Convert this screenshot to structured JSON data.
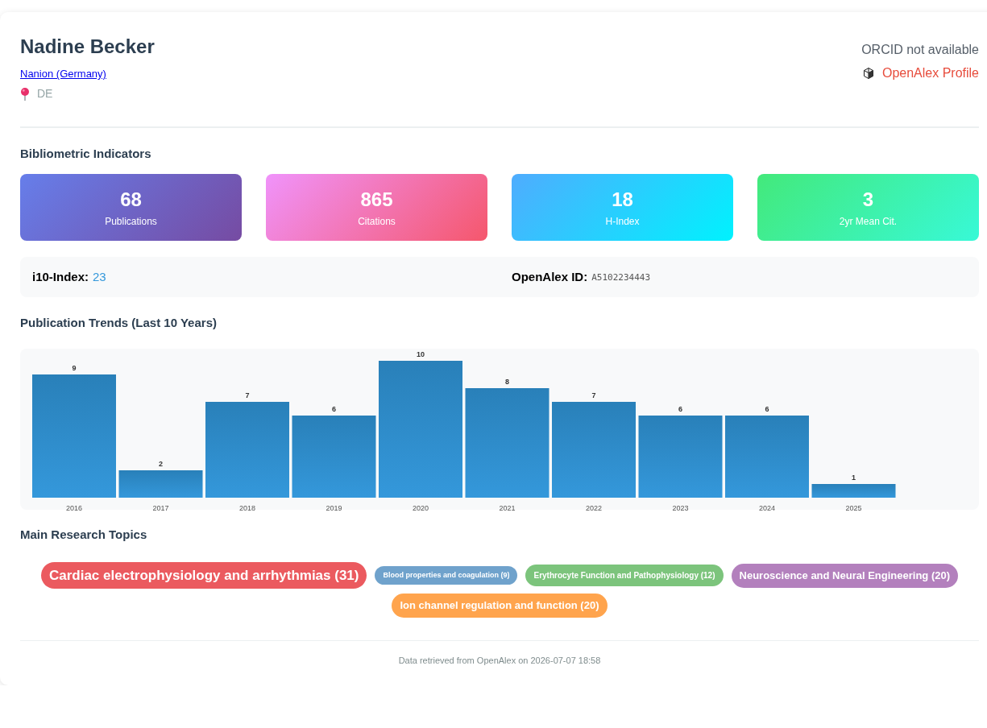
{
  "profile": {
    "name": "Nadine Becker",
    "affiliation": "Nanion (Germany)",
    "country": "DE",
    "orcid": "ORCID not available",
    "openalex_link": "OpenAlex Profile"
  },
  "bibliometric_indicators": {
    "title": "Bibliometric Indicators",
    "stats": [
      {
        "value": "68",
        "label": "Publications",
        "kind": "violet"
      },
      {
        "value": "865",
        "label": "Citations",
        "kind": "rose"
      },
      {
        "value": "18",
        "label": "H-Index",
        "kind": "azure"
      },
      {
        "value": "3",
        "label": "2yr Mean Cit.",
        "kind": "mint"
      }
    ]
  },
  "details": {
    "i10_label": "i10-Index:",
    "i10_value": "23",
    "openalex_id_label": "OpenAlex ID:",
    "openalex_id": "A5102234443"
  },
  "publication_trends": {
    "title": "Publication Trends (Last 10 Years)",
    "chart_data": {
      "type": "bar",
      "categories": [
        "2016",
        "2017",
        "2018",
        "2019",
        "2020",
        "2021",
        "2022",
        "2023",
        "2024",
        "2025"
      ],
      "values": [
        9,
        2,
        7,
        6,
        10,
        8,
        7,
        6,
        6,
        1
      ],
      "data_labels": true
    }
  },
  "research_topics": {
    "title": "Main Research Topics",
    "topics": [
      {
        "label": "Cardiac electrophysiology and arrhythmias (31)",
        "kind": "large",
        "color": "#eb5a5f"
      },
      {
        "label": "Blood properties and coagulation (9)",
        "kind": "tiny",
        "color": "#6fa2cc"
      },
      {
        "label": "Erythrocyte Function and Pathophysiology (12)",
        "kind": "small",
        "color": "#7cc47c"
      },
      {
        "label": "Neuroscience and Neural Engineering (20)",
        "kind": "medium",
        "color": "#b380bd"
      },
      {
        "label": "Ion channel regulation and function (20)",
        "kind": "medium",
        "color": "#ffa44d"
      }
    ]
  },
  "footer": "Data retrieved from OpenAlex on 2026-07-07 18:58"
}
